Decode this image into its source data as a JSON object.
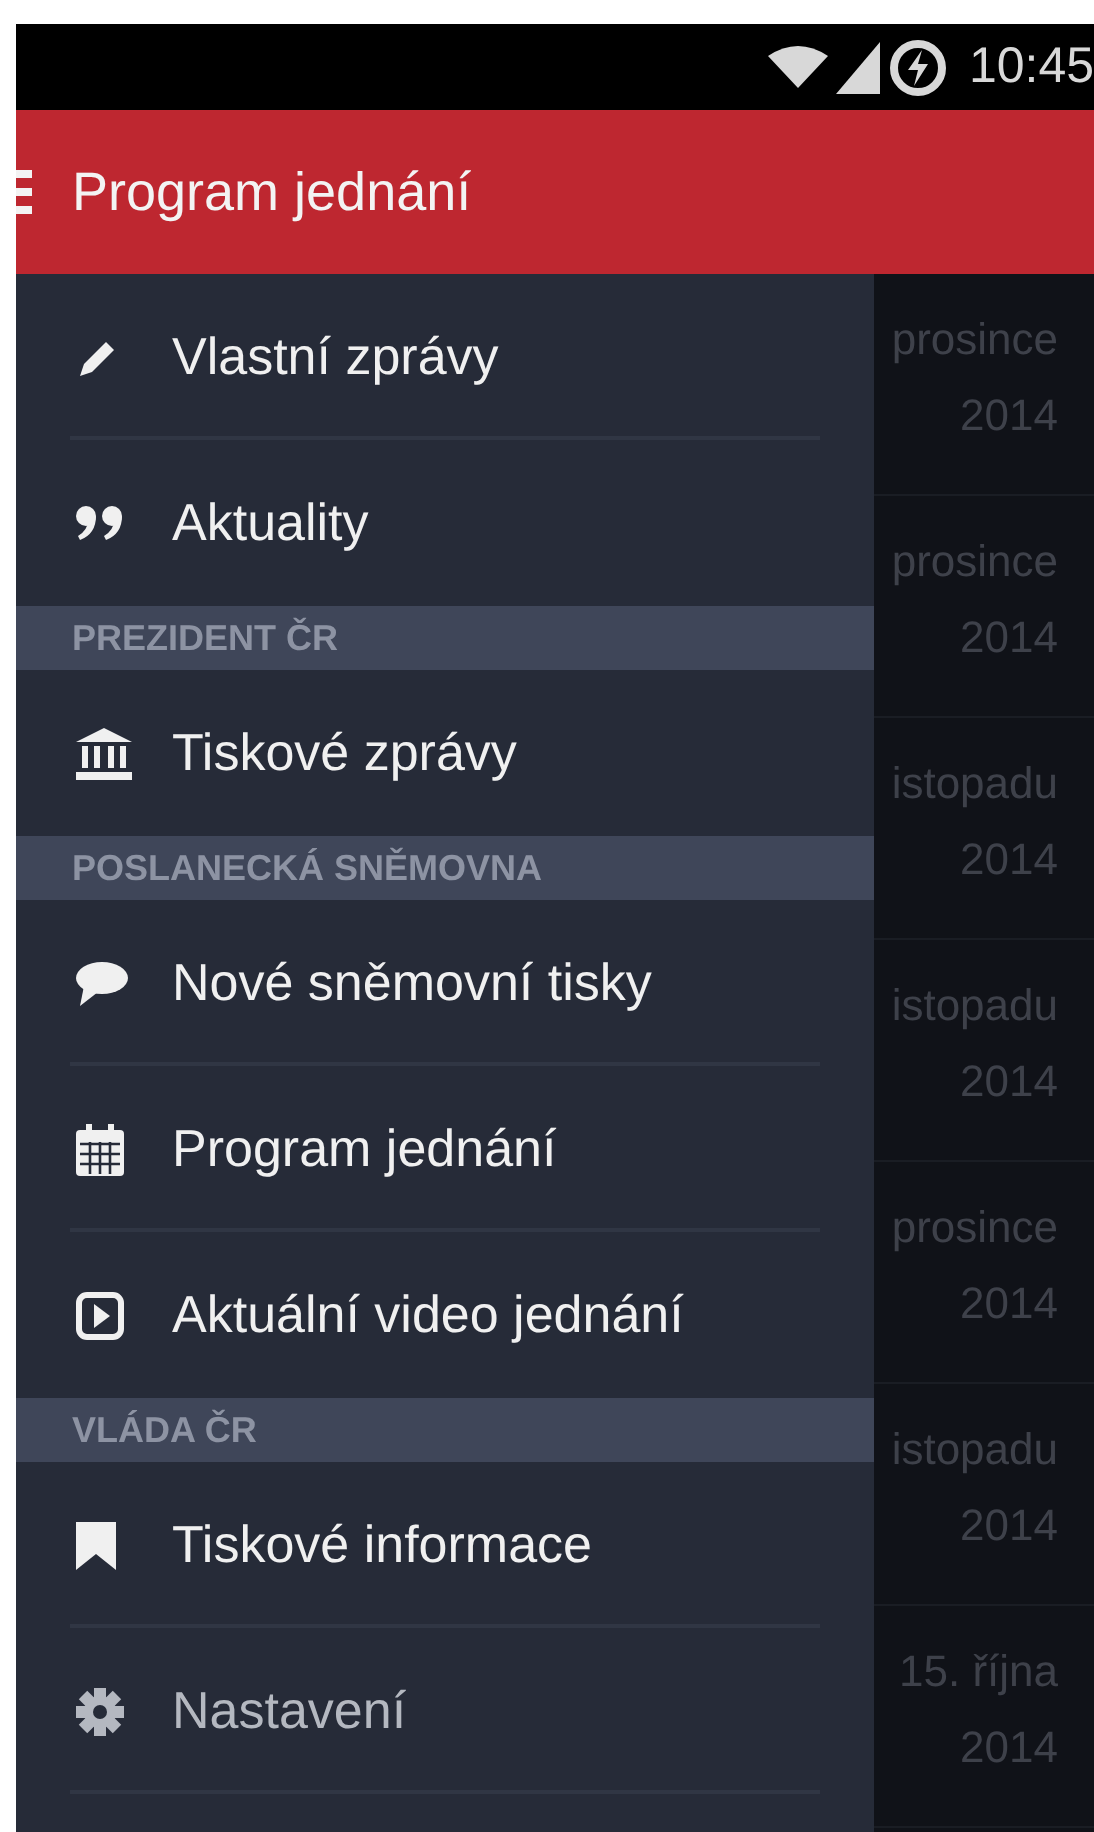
{
  "status_bar": {
    "time": "10:45"
  },
  "app_bar": {
    "title": "Program jednání"
  },
  "drawer": {
    "entries": [
      {
        "kind": "item",
        "label": "Vlastní zprávy",
        "disabled": false
      },
      {
        "kind": "item",
        "label": "Aktuality",
        "disabled": false
      },
      {
        "kind": "header",
        "label": "PREZIDENT ČR"
      },
      {
        "kind": "item",
        "label": "Tiskové zprávy",
        "disabled": false
      },
      {
        "kind": "header",
        "label": "POSLANECKÁ SNĚMOVNA"
      },
      {
        "kind": "item",
        "label": "Nové sněmovní tisky",
        "disabled": false
      },
      {
        "kind": "item",
        "label": "Program jednání",
        "disabled": false
      },
      {
        "kind": "item",
        "label": "Aktuální video jednání",
        "disabled": false
      },
      {
        "kind": "header",
        "label": "VLÁDA ČR"
      },
      {
        "kind": "item",
        "label": "Tiskové informace",
        "disabled": false
      },
      {
        "kind": "item",
        "label": "Nastavení",
        "disabled": true
      }
    ]
  },
  "background_list": [
    {
      "line_1": "prosince",
      "line_2": "2014"
    },
    {
      "line_1": "prosince",
      "line_2": "2014"
    },
    {
      "line_1": "istopadu",
      "line_2": "2014"
    },
    {
      "line_1": "istopadu",
      "line_2": "2014"
    },
    {
      "line_1": "prosince",
      "line_2": "2014"
    },
    {
      "line_1": "istopadu",
      "line_2": "2014"
    },
    {
      "line_1": "15. října",
      "line_2": "2014"
    }
  ]
}
